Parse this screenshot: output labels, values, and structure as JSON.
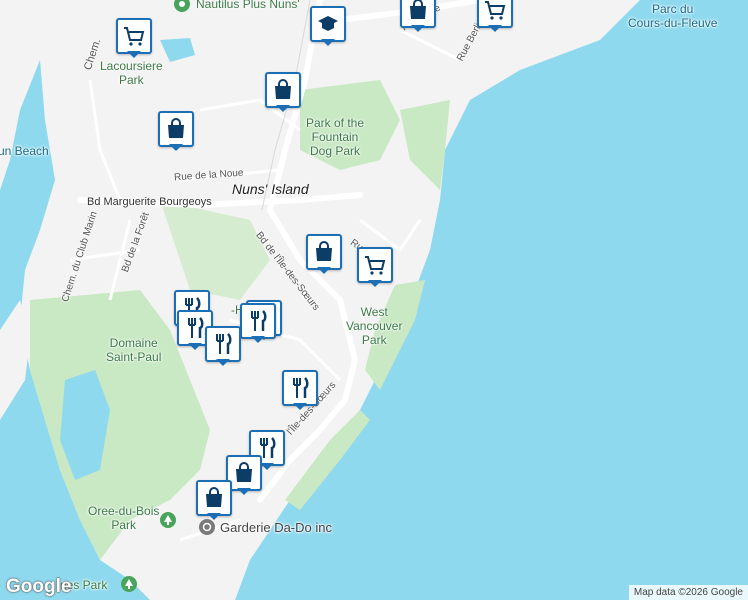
{
  "map": {
    "water_color": "#8fd9ee",
    "land_color": "#f3f3f3",
    "park_color": "#c9e8c4",
    "pin_color": "#1c6fb5"
  },
  "place_labels": {
    "nuns_island": "Nuns' Island",
    "lacoursiere_park": "Lacoursiere\nPark",
    "park_of_the_fountain": "Park of the\nFountain\nDog Park",
    "west_vancouver_park": "West\nVancouver\nPark",
    "domaine_saint_paul": "Domaine\nSaint-Paul",
    "oree_du_bois_park": "Oree-du-Bois\nPark",
    "garderie": "Garderie Da-Do inc",
    "nautilus": "Nautilus Plus Nuns'",
    "parc_du_cours": "Parc du\nCours-du-Fleuve",
    "un_beach": "un Beach",
    "nes_park": "nes Park",
    "ha_partial": "-Ha"
  },
  "street_labels": {
    "bd_marguerite": "Bd Marguerite Bourgeoys",
    "rue_de_la_noue": "Rue de la Noue",
    "bd_de_lile": "Bd de l'Île-des-Sœurs",
    "bd_de_la_foret": "Bd de la Forêt",
    "chem_club_marin": "Chem. du Club Marin",
    "rue_berlioz": "Rue Berlioz",
    "chem_top": "Chem.",
    "ru_partial": "Ru",
    "lile_lower": "l'Île-des-Sœurs",
    "rue_leve": "Rue Leve"
  },
  "pins": [
    {
      "type": "grocery",
      "icon": "cart-icon"
    },
    {
      "type": "education",
      "icon": "school-icon"
    },
    {
      "type": "shopping",
      "icon": "bag-icon"
    },
    {
      "type": "grocery",
      "icon": "cart-icon"
    },
    {
      "type": "shopping",
      "icon": "bag-icon"
    },
    {
      "type": "shopping",
      "icon": "bag-icon"
    },
    {
      "type": "shopping",
      "icon": "bag-icon"
    },
    {
      "type": "grocery",
      "icon": "cart-icon"
    },
    {
      "type": "restaurant",
      "icon": "fork-knife-icon"
    },
    {
      "type": "restaurant",
      "icon": "fork-knife-icon"
    },
    {
      "type": "restaurant",
      "icon": "fork-knife-icon"
    },
    {
      "type": "restaurant",
      "icon": "fork-knife-icon"
    },
    {
      "type": "restaurant",
      "icon": "fork-knife-icon"
    },
    {
      "type": "restaurant",
      "icon": "fork-knife-icon"
    },
    {
      "type": "shopping",
      "icon": "bag-icon"
    },
    {
      "type": "shopping",
      "icon": "bag-icon"
    }
  ],
  "logo": "Google",
  "attribution": "Map data ©2026 Google"
}
